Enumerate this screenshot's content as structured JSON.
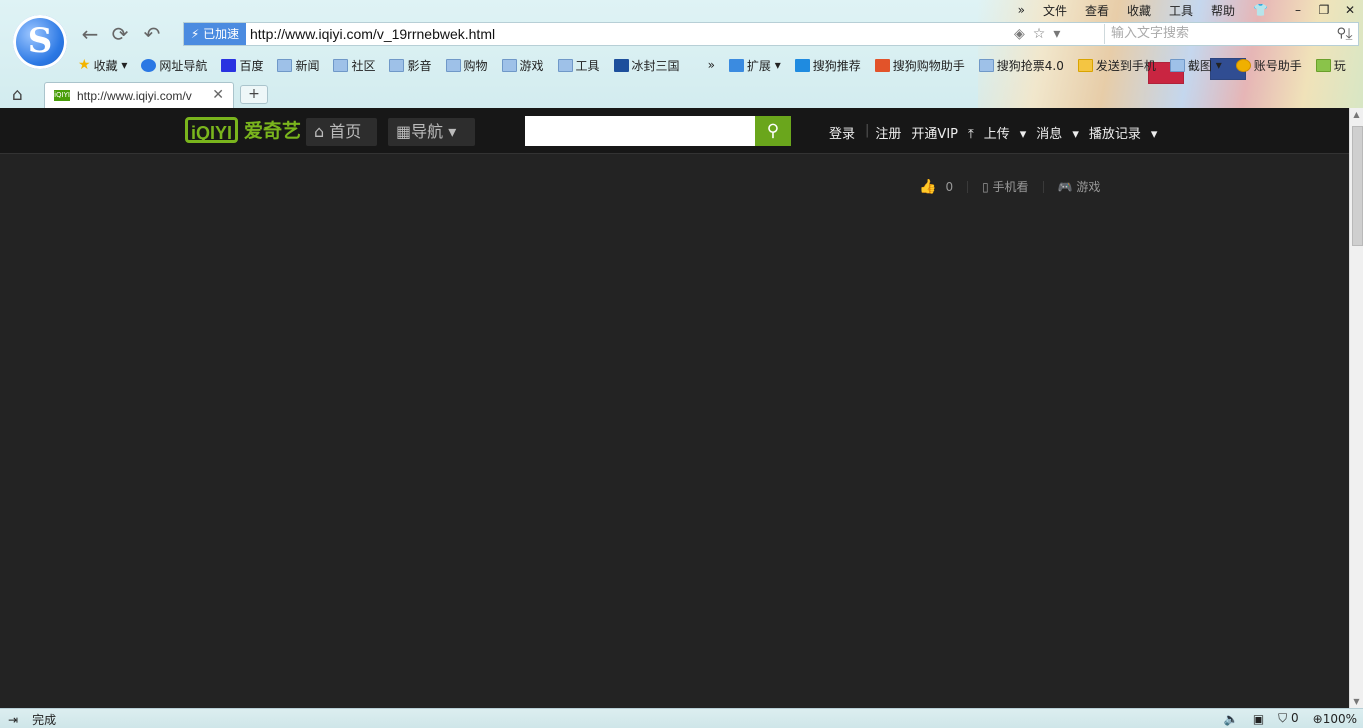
{
  "browser": {
    "accel_label": "已加速",
    "url": "http://www.iqiyi.com/v_19rrnebwek.html",
    "search_placeholder": "输入文字搜索",
    "menu": [
      "文件",
      "查看",
      "收藏",
      "工具",
      "帮助"
    ],
    "bookmarks": [
      "收藏",
      "网址导航",
      "百度",
      "新闻",
      "社区",
      "影音",
      "购物",
      "游戏",
      "工具",
      "冰封三国",
      "扩展",
      "搜狗推荐",
      "搜狗购物助手",
      "搜狗抢票4.0",
      "发送到手机",
      "截图",
      "账号助手",
      "玩"
    ],
    "tab_title": "http://www.iqiyi.com/v",
    "status_text": "完成",
    "status_count": "0",
    "zoom": "100%"
  },
  "site": {
    "logo_text": "iQIYI",
    "logo_cn": "爱奇艺",
    "home_label": "首页",
    "nav_label": "导航",
    "search_value": "",
    "login": "登录",
    "register": "注册",
    "vip": "开通VIP",
    "upload": "上传",
    "messages": "消息",
    "history": "播放记录"
  },
  "stats": {
    "likes": "0",
    "mobile": "手机看",
    "games": "游戏"
  },
  "colors": {
    "accent": "#7ab51d",
    "page_bg": "#232323",
    "topbar_bg": "#171717"
  }
}
